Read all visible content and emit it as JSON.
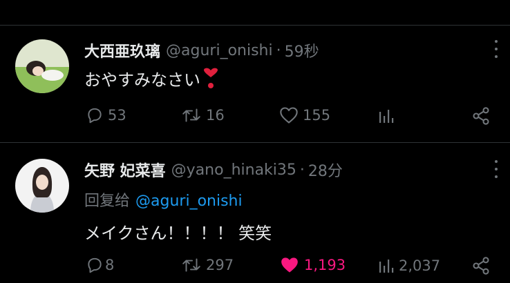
{
  "colors": {
    "background": "#000000",
    "primary_text": "#e7e9ea",
    "secondary_text": "#71767b",
    "link": "#1d9bf0",
    "like_active": "#f91880",
    "divider": "#2f3336"
  },
  "tweets": [
    {
      "display_name": "大西亜玖璃",
      "handle": "@aguri_onishi",
      "separator": "·",
      "time": "59秒",
      "text": "おやすみなさい",
      "emoji": "heart-exclamation-icon",
      "replies": "53",
      "retweets": "16",
      "likes": "155",
      "liked": false,
      "views": ""
    },
    {
      "display_name": "矢野 妃菜喜",
      "handle": "@yano_hinaki35",
      "separator": "·",
      "time": "28分",
      "reply_prefix": "回复给",
      "reply_to": "@aguri_onishi",
      "text": "メイクさん！！！！ 笑笑",
      "replies": "8",
      "retweets": "297",
      "likes": "1,193",
      "liked": true,
      "views": "2,037"
    }
  ]
}
